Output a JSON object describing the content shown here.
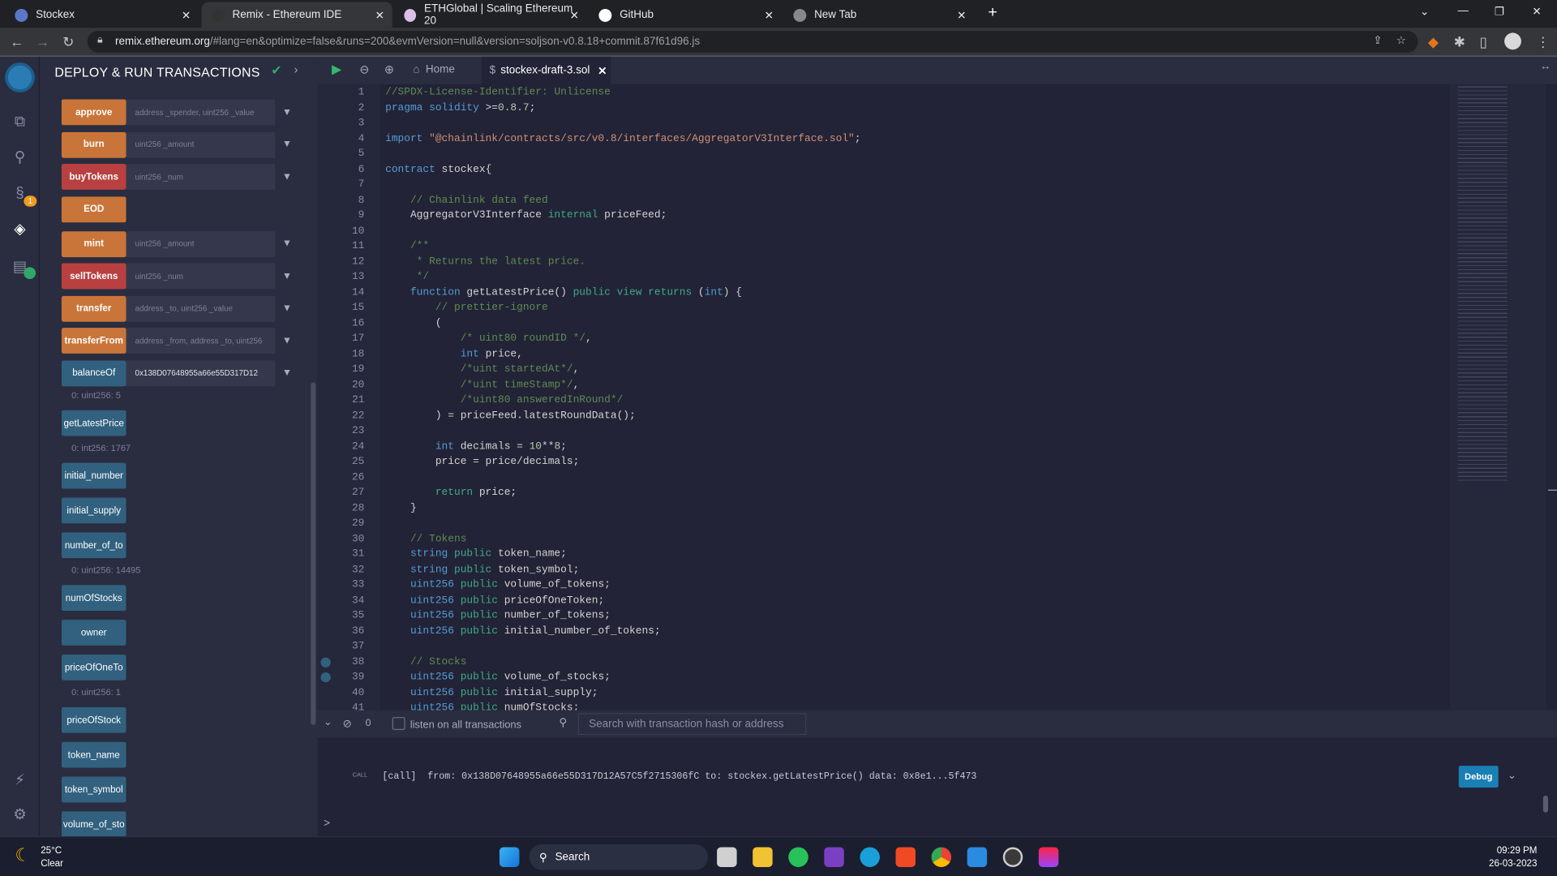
{
  "browser": {
    "tabs": [
      {
        "title": "Stockex",
        "close": "✕",
        "color": "#5a78c8"
      },
      {
        "title": "Remix - Ethereum IDE",
        "close": "✕",
        "color": "#333"
      },
      {
        "title": "ETHGlobal | Scaling Ethereum 20",
        "close": "✕",
        "color": "#d8c0e8"
      },
      {
        "title": "GitHub",
        "close": "✕",
        "color": "#fff"
      },
      {
        "title": "New Tab",
        "close": "✕",
        "color": "#888"
      }
    ],
    "new_tab": "+",
    "url_host": "remix.ethereum.org",
    "url_rest": "/#lang=en&optimize=false&runs=200&evmVersion=null&version=soljson-v0.8.18+commit.87f61d96.js"
  },
  "panel": {
    "title": "DEPLOY & RUN TRANSACTIONS",
    "functions": [
      {
        "label": "approve",
        "color": "orange",
        "input": "address _spender, uint256 _value",
        "chevron": true
      },
      {
        "label": "burn",
        "color": "orange",
        "input": "uint256 _amount",
        "chevron": true
      },
      {
        "label": "buyTokens",
        "color": "red",
        "input": "uint256 _num",
        "chevron": true
      },
      {
        "label": "EOD",
        "color": "orange"
      },
      {
        "label": "mint",
        "color": "orange",
        "input": "uint256 _amount",
        "chevron": true
      },
      {
        "label": "sellTokens",
        "color": "red",
        "input": "uint256 _num",
        "chevron": true
      },
      {
        "label": "transfer",
        "color": "orange",
        "input": "address _to, uint256 _value",
        "chevron": true
      },
      {
        "label": "transferFrom",
        "color": "orange",
        "input": "address _from, address _to, uint256",
        "chevron": true
      },
      {
        "label": "balanceOf",
        "color": "blue",
        "value": "0x138D07648955a66e55D317D12",
        "chevron": true,
        "result": "0: uint256: 5"
      },
      {
        "label": "getLatestPrice",
        "color": "blue",
        "result": "0: int256: 1767"
      },
      {
        "label": "initial_number",
        "color": "blue"
      },
      {
        "label": "initial_supply",
        "color": "blue"
      },
      {
        "label": "number_of_to",
        "color": "blue",
        "result": "0: uint256: 14495"
      },
      {
        "label": "numOfStocks",
        "color": "blue"
      },
      {
        "label": "owner",
        "color": "blue"
      },
      {
        "label": "priceOfOneTo",
        "color": "blue",
        "result": "0: uint256: 1"
      },
      {
        "label": "priceOfStock",
        "color": "blue"
      },
      {
        "label": "token_name",
        "color": "blue"
      },
      {
        "label": "token_symbol",
        "color": "blue"
      },
      {
        "label": "volume_of_sto",
        "color": "blue"
      }
    ],
    "plugin_badge": "1"
  },
  "editor": {
    "home_tab": "Home",
    "file_tab": "stockex-draft-3.sol",
    "breakpoint_lines": [
      38,
      39
    ],
    "lines": [
      [
        [
          "c",
          "//SPDX-License-Identifier: Unlicense"
        ]
      ],
      [
        [
          "k",
          "pragma solidity "
        ],
        [
          "d",
          ">="
        ],
        [
          "n",
          "0.8.7"
        ],
        [
          "d",
          ";"
        ]
      ],
      [],
      [
        [
          "k",
          "import "
        ],
        [
          "s",
          "\"@chainlink/contracts/src/v0.8/interfaces/AggregatorV3Interface.sol\""
        ],
        [
          "d",
          ";"
        ]
      ],
      [],
      [
        [
          "k",
          "contract "
        ],
        [
          "d",
          "stockex{"
        ]
      ],
      [],
      [
        [
          "c",
          "    // Chainlink data feed"
        ]
      ],
      [
        [
          "d",
          "    AggregatorV3Interface "
        ],
        [
          "g",
          "internal "
        ],
        [
          "d",
          "priceFeed;"
        ]
      ],
      [],
      [
        [
          "c",
          "    /**"
        ]
      ],
      [
        [
          "c",
          "     * Returns the latest price."
        ]
      ],
      [
        [
          "c",
          "     */"
        ]
      ],
      [
        [
          "k",
          "    function "
        ],
        [
          "d",
          "getLatestPrice() "
        ],
        [
          "g",
          "public view returns "
        ],
        [
          "d",
          "("
        ],
        [
          "k",
          "int"
        ],
        [
          "d",
          ") {"
        ]
      ],
      [
        [
          "c",
          "        // prettier-ignore"
        ]
      ],
      [
        [
          "d",
          "        ("
        ]
      ],
      [
        [
          "c",
          "            /* uint80 roundID */"
        ],
        [
          "d",
          ","
        ]
      ],
      [
        [
          "k",
          "            int "
        ],
        [
          "d",
          "price,"
        ]
      ],
      [
        [
          "c",
          "            /*uint startedAt*/"
        ],
        [
          "d",
          ","
        ]
      ],
      [
        [
          "c",
          "            /*uint timeStamp*/"
        ],
        [
          "d",
          ","
        ]
      ],
      [
        [
          "c",
          "            /*uint80 answeredInRound*/"
        ]
      ],
      [
        [
          "d",
          "        ) = priceFeed.latestRoundData();"
        ]
      ],
      [],
      [
        [
          "k",
          "        int "
        ],
        [
          "d",
          "decimals = "
        ],
        [
          "n",
          "10"
        ],
        [
          "d",
          "**"
        ],
        [
          "n",
          "8"
        ],
        [
          "d",
          ";"
        ]
      ],
      [
        [
          "d",
          "        price = price/decimals;"
        ]
      ],
      [],
      [
        [
          "g",
          "        return "
        ],
        [
          "d",
          "price;"
        ]
      ],
      [
        [
          "d",
          "    }"
        ]
      ],
      [],
      [
        [
          "c",
          "    // Tokens"
        ]
      ],
      [
        [
          "k",
          "    string "
        ],
        [
          "g",
          "public "
        ],
        [
          "d",
          "token_name;"
        ]
      ],
      [
        [
          "k",
          "    string "
        ],
        [
          "g",
          "public "
        ],
        [
          "d",
          "token_symbol;"
        ]
      ],
      [
        [
          "k",
          "    uint256 "
        ],
        [
          "g",
          "public "
        ],
        [
          "d",
          "volume_of_tokens;"
        ]
      ],
      [
        [
          "k",
          "    uint256 "
        ],
        [
          "g",
          "public "
        ],
        [
          "d",
          "priceOfOneToken;"
        ]
      ],
      [
        [
          "k",
          "    uint256 "
        ],
        [
          "g",
          "public "
        ],
        [
          "d",
          "number_of_tokens;"
        ]
      ],
      [
        [
          "k",
          "    uint256 "
        ],
        [
          "g",
          "public "
        ],
        [
          "d",
          "initial_number_of_tokens;"
        ]
      ],
      [],
      [
        [
          "c",
          "    // Stocks"
        ]
      ],
      [
        [
          "k",
          "    uint256 "
        ],
        [
          "g",
          "public "
        ],
        [
          "d",
          "volume_of_stocks;"
        ]
      ],
      [
        [
          "k",
          "    uint256 "
        ],
        [
          "g",
          "public "
        ],
        [
          "d",
          "initial_supply;"
        ]
      ],
      [
        [
          "k",
          "    uint256 "
        ],
        [
          "g",
          "public "
        ],
        [
          "d",
          "numOfStocks;"
        ]
      ]
    ]
  },
  "terminal": {
    "pending_count": "0",
    "listen_label": "listen on all transactions",
    "search_placeholder": "Search with transaction hash or address",
    "log_tag": "CALL",
    "log_text": "[call]  from: 0x138D07648955a66e55D317D12A57C5f2715306fC to: stockex.getLatestPrice() data: 0x8e1...5f473",
    "debug_label": "Debug",
    "prompt": ">"
  },
  "taskbar": {
    "temperature": "25°C",
    "weather": "Clear",
    "search_label": "Search",
    "time": "09:29 PM",
    "date": "26-03-2023"
  },
  "colors": {
    "orange": "#c97539",
    "red": "#b84040",
    "blue": "#31617f",
    "accent": "#1a7fb5"
  }
}
